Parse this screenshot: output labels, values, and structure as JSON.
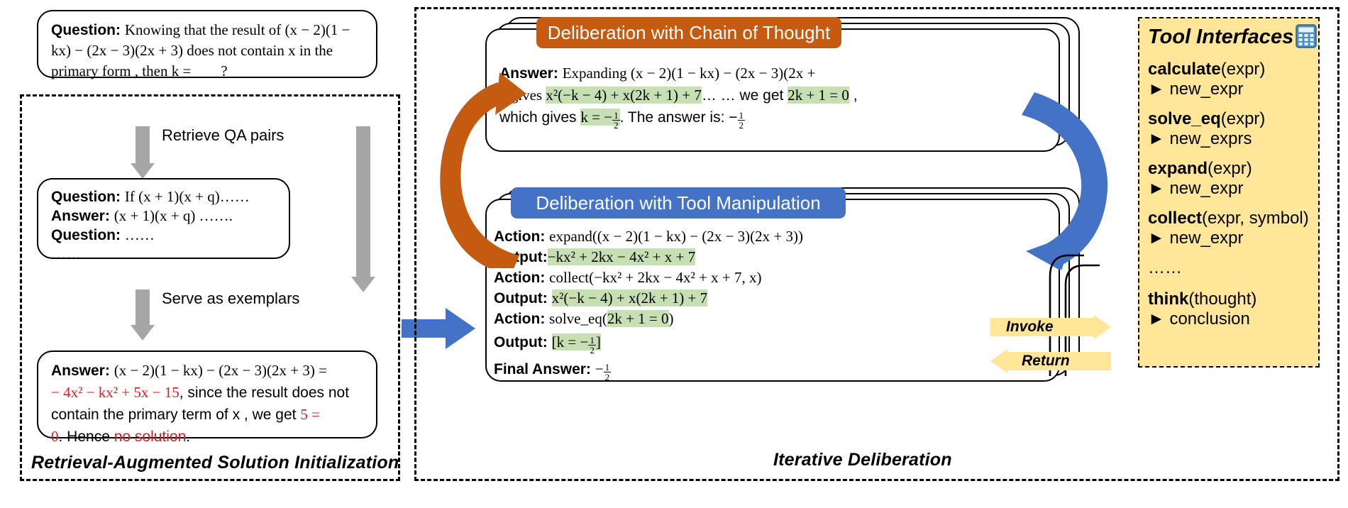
{
  "sections": {
    "left": {
      "caption": "Retrieval-Augmented Solution Initialization"
    },
    "right": {
      "caption": "Iterative Deliberation"
    }
  },
  "question_card": {
    "label": "Question:",
    "line1": "Knowing that the result of (x − 2)(1 −",
    "line2": "kx) − (2x − 3)(2x + 3) does not contain x in the",
    "line3": "primary form , then k = ___ ?"
  },
  "flow_arrows": {
    "retrieve": "Retrieve QA pairs",
    "serve": "Serve as exemplars"
  },
  "exemplar_card": {
    "q1_label": "Question:",
    "q1_text": "If  (x + 1)(x + q)……",
    "a1_label": "Answer:",
    "a1_text": "(x + 1)(x + q) …….",
    "q2_label": "Question:",
    "q2_text": "……",
    "ellipsis": "……"
  },
  "initial_answer_card": {
    "label": "Answer:",
    "line1_black": "(x − 2)(1 − kx) − (2x − 3)(2x + 3) =",
    "line2_red": "− 4x² − kx² + 5x − 15",
    "line2_black": ", since the result does not",
    "line3_black": "contain the primary term of x , we get ",
    "line3_red": "5 =",
    "line4_red_a": "0",
    "line4_black": ". Hence ",
    "line4_red_b": "no solution",
    "line4_period": "."
  },
  "cot": {
    "header": "Deliberation with Chain of Thought",
    "answer_label": "Answer:",
    "l1": "Expanding (x − 2)(1 − kx) − (2x − 3)(2x +",
    "l2_pre": "3 gives ",
    "l2_hl": "x²(−k − 4) + x(2k + 1) + 7",
    "l2_mid": "… … we get ",
    "l2_hl2": "2k + 1 = 0",
    "l2_post": " ,",
    "l3_pre": "which gives ",
    "l3_hl": "k = −1/2",
    "l3_post": ". The answer is: −1/2"
  },
  "tool": {
    "header": "Deliberation with Tool Manipulation",
    "rows": [
      {
        "label": "Action:",
        "value": "expand((x − 2)(1 − kx) − (2x − 3)(2x + 3))",
        "highlight": false
      },
      {
        "label": "Output:",
        "value": "−kx² + 2kx − 4x² + x + 7",
        "highlight": true
      },
      {
        "label": "Action:",
        "value": "collect(−kx² + 2kx − 4x² + x + 7, x)",
        "highlight": false
      },
      {
        "label": "Output:",
        "value": "x²(−k − 4) + x(2k + 1) + 7",
        "highlight": true
      },
      {
        "label": "Action:",
        "value": "solve_eq(2k + 1 = 0)",
        "highlight": "partial"
      },
      {
        "label": "Output:",
        "value": "[k = −1/2]",
        "highlight": true
      },
      {
        "label": "Final Answer:",
        "value": "−1/2",
        "highlight": false
      }
    ]
  },
  "tool_interfaces": {
    "title": "Tool Interfaces",
    "title_icon": "calculator-icon",
    "items": [
      {
        "name": "calculate",
        "args": "(expr)",
        "returns": "new_expr"
      },
      {
        "name": "solve_eq",
        "args": "(expr)",
        "returns": "new_exprs"
      },
      {
        "name": "expand",
        "args": "(expr)",
        "returns": "new_expr"
      },
      {
        "name": "collect",
        "args": "(expr, symbol)",
        "returns": "new_expr"
      },
      {
        "name": "……",
        "args": "",
        "returns": ""
      },
      {
        "name": "think",
        "args": "(thought)",
        "returns": "conclusion"
      }
    ],
    "return_marker": "►"
  },
  "exchange": {
    "invoke": "Invoke",
    "return": "Return"
  },
  "colors": {
    "cot_header": "#C55A11",
    "tool_header": "#4472C4",
    "highlight_green": "#C6E0B4",
    "panel_yellow": "#FFE699",
    "red_text": "#D22027",
    "grey_arrow": "#A6A6A6",
    "flag_yellow": "#FFE699"
  }
}
